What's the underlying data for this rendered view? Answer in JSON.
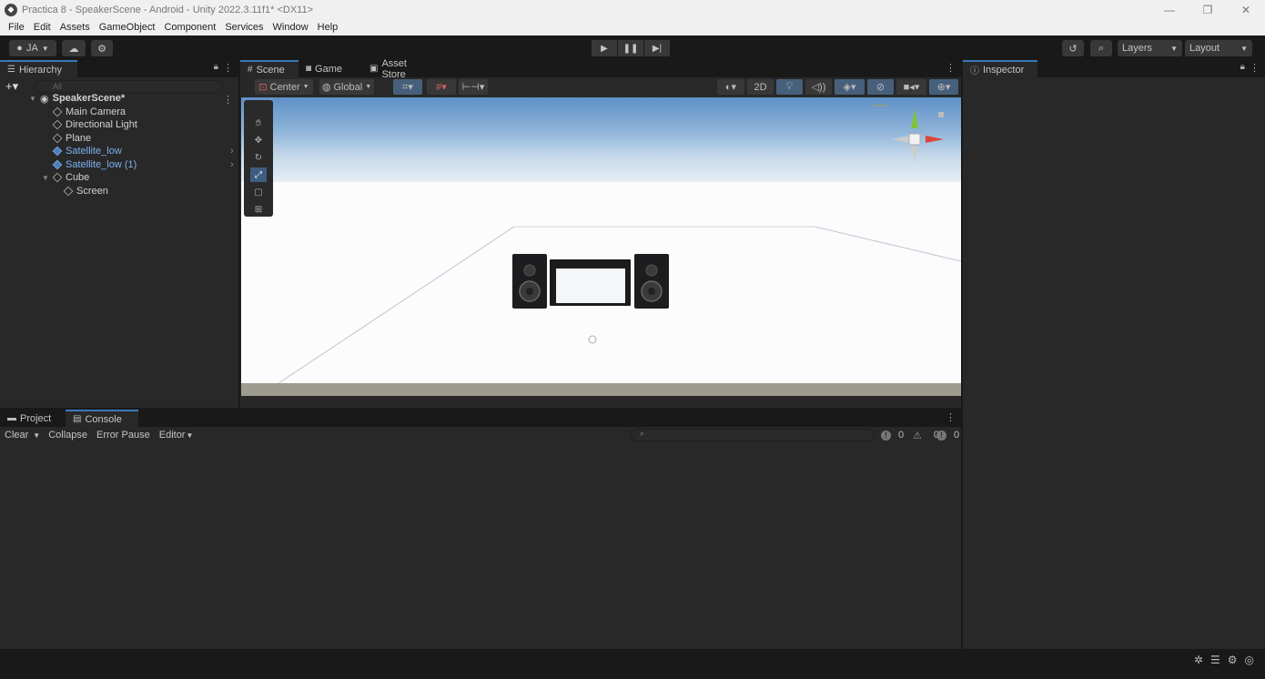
{
  "window": {
    "title": "Practica 8 - SpeakerScene - Android - Unity 2022.3.11f1* <DX11>",
    "controls": [
      "—",
      "❐",
      "✕"
    ]
  },
  "menu": [
    "File",
    "Edit",
    "Assets",
    "GameObject",
    "Component",
    "Services",
    "Window",
    "Help"
  ],
  "toolbar": {
    "account": "JA",
    "layers": "Layers",
    "layout": "Layout"
  },
  "hierarchy": {
    "tab": "Hierarchy",
    "search_placeholder": "All",
    "scene": "SpeakerScene*",
    "items": [
      {
        "label": "Main Camera"
      },
      {
        "label": "Directional Light"
      },
      {
        "label": "Plane"
      },
      {
        "label": "Satellite_low"
      },
      {
        "label": "Satellite_low (1)"
      },
      {
        "label": "Cube"
      },
      {
        "label": "Screen"
      }
    ]
  },
  "scene": {
    "tabs": [
      "Scene",
      "Game",
      "Asset Store"
    ],
    "pivot": "Center",
    "space": "Global",
    "mode2d": "2D"
  },
  "inspector": {
    "tab": "Inspector"
  },
  "bottom": {
    "tabs": [
      "Project",
      "Console"
    ],
    "buttons": [
      "Clear",
      "Collapse",
      "Error Pause",
      "Editor"
    ],
    "counts": {
      "logs": "0",
      "warnings": "0",
      "errors": "0"
    }
  },
  "colors": {
    "accent": "#3a79bb",
    "prefab": "#7bb0ef",
    "panel": "#282828",
    "background": "#191919"
  }
}
